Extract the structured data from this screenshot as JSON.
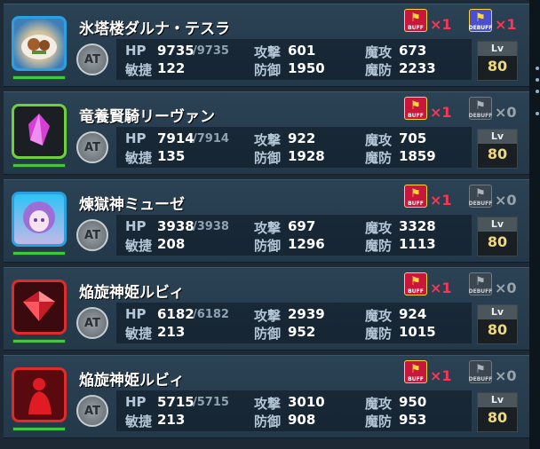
{
  "labels": {
    "hp": "HP",
    "agi": "敏捷",
    "atk": "攻撃",
    "def": "防御",
    "matk": "魔攻",
    "mdef": "魔防",
    "lv": "Lv",
    "at": "AT",
    "buff": "BUFF",
    "debuff": "DEBUFF"
  },
  "colors": {
    "buff_active": "#ff3355",
    "debuff_active": "#ff3355",
    "inactive": "#9aa3a9"
  },
  "units": [
    {
      "name": "氷塔楼ダルナ・テスラ",
      "portrait": "food-plate",
      "frame_color": "#2b9fe0",
      "hp": "9735",
      "hp_max": "/9735",
      "agi": "122",
      "atk": "601",
      "def": "1950",
      "matk": "673",
      "mdef": "2233",
      "lv": "80",
      "buff_count": "×1",
      "debuff_count": "×1",
      "debuff_active": true
    },
    {
      "name": "竜養賢騎リーヴァン",
      "portrait": "crystal",
      "frame_color": "#6fd03a",
      "hp": "7914",
      "hp_max": "/7914",
      "agi": "135",
      "atk": "922",
      "def": "1928",
      "matk": "705",
      "mdef": "1859",
      "lv": "80",
      "buff_count": "×1",
      "debuff_count": "×0",
      "debuff_active": false
    },
    {
      "name": "煉獄神ミューゼ",
      "portrait": "purple-hair-girl",
      "frame_color": "#2b9fe0",
      "hp": "3938",
      "hp_max": "/3938",
      "agi": "208",
      "atk": "697",
      "def": "1296",
      "matk": "3328",
      "mdef": "1113",
      "lv": "80",
      "buff_count": "×1",
      "debuff_count": "×0",
      "debuff_active": false
    },
    {
      "name": "焔旋神姫ルビィ",
      "portrait": "red-gem",
      "frame_color": "#e02b2b",
      "hp": "6182",
      "hp_max": "/6182",
      "agi": "213",
      "atk": "2939",
      "def": "952",
      "matk": "924",
      "mdef": "1015",
      "lv": "80",
      "buff_count": "×1",
      "debuff_count": "×0",
      "debuff_active": false
    },
    {
      "name": "焔旋神姫ルビィ",
      "portrait": "red-silhouette",
      "frame_color": "#e02b2b",
      "hp": "5715",
      "hp_max": "/5715",
      "agi": "213",
      "atk": "3010",
      "def": "908",
      "matk": "950",
      "mdef": "953",
      "lv": "80",
      "buff_count": "×1",
      "debuff_count": "×0",
      "debuff_active": false
    }
  ]
}
